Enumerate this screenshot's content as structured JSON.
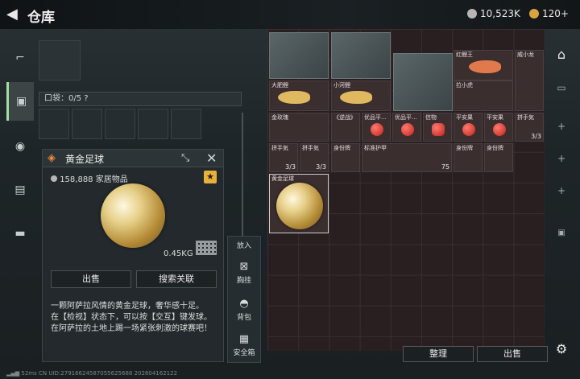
{
  "header": {
    "title": "仓库",
    "currency1": "10,523K",
    "currency2": "120+"
  },
  "pocket": {
    "label": "口袋：0/5",
    "help": "?"
  },
  "item": {
    "name": "黄金足球",
    "price": "158,888",
    "category": "家居物品",
    "weight": "0.45KG",
    "sell": "出售",
    "search": "搜索关联",
    "description": [
      "一颗阿萨拉风情的黄金足球，奢华感十足。",
      "在【检视】状态下，可以按【交互】键发球。",
      "在阿萨拉的土地上踢一场紧张刺激的球赛吧！"
    ]
  },
  "side": {
    "put": "放入",
    "chest": "胸挂",
    "bag": "背包",
    "safe": "安全箱"
  },
  "inventory": {
    "fish1": "红鲤王",
    "name_xl": "威小龙",
    "fish2": "大肥鲤",
    "fish3": "小河鲤",
    "toy": "拉小虎",
    "rose": "金玫瑰",
    "card": "《逆战》",
    "apple1": "优品平...",
    "apple2": "优品平...",
    "mask": "信物",
    "apple3": "平安果",
    "apple4": "平安果",
    "charm1": "拼手気",
    "charm2": "拼手気",
    "charm3": "拼手気",
    "tag1": "身份牌",
    "tag2": "身份牌",
    "armor": "标准护甲",
    "tag3": "身份牌",
    "tag4": "身份牌",
    "ball": "黄金足球",
    "cnt_a": "3/3",
    "cnt_b": "3/3",
    "cnt_c": "3/3",
    "cnt_armor": "75"
  },
  "bottom": {
    "sort": "整理",
    "sell": "出售"
  },
  "footer": {
    "ping": "52ms",
    "uid": "CN UID:27916624587055625688 202604162122"
  }
}
